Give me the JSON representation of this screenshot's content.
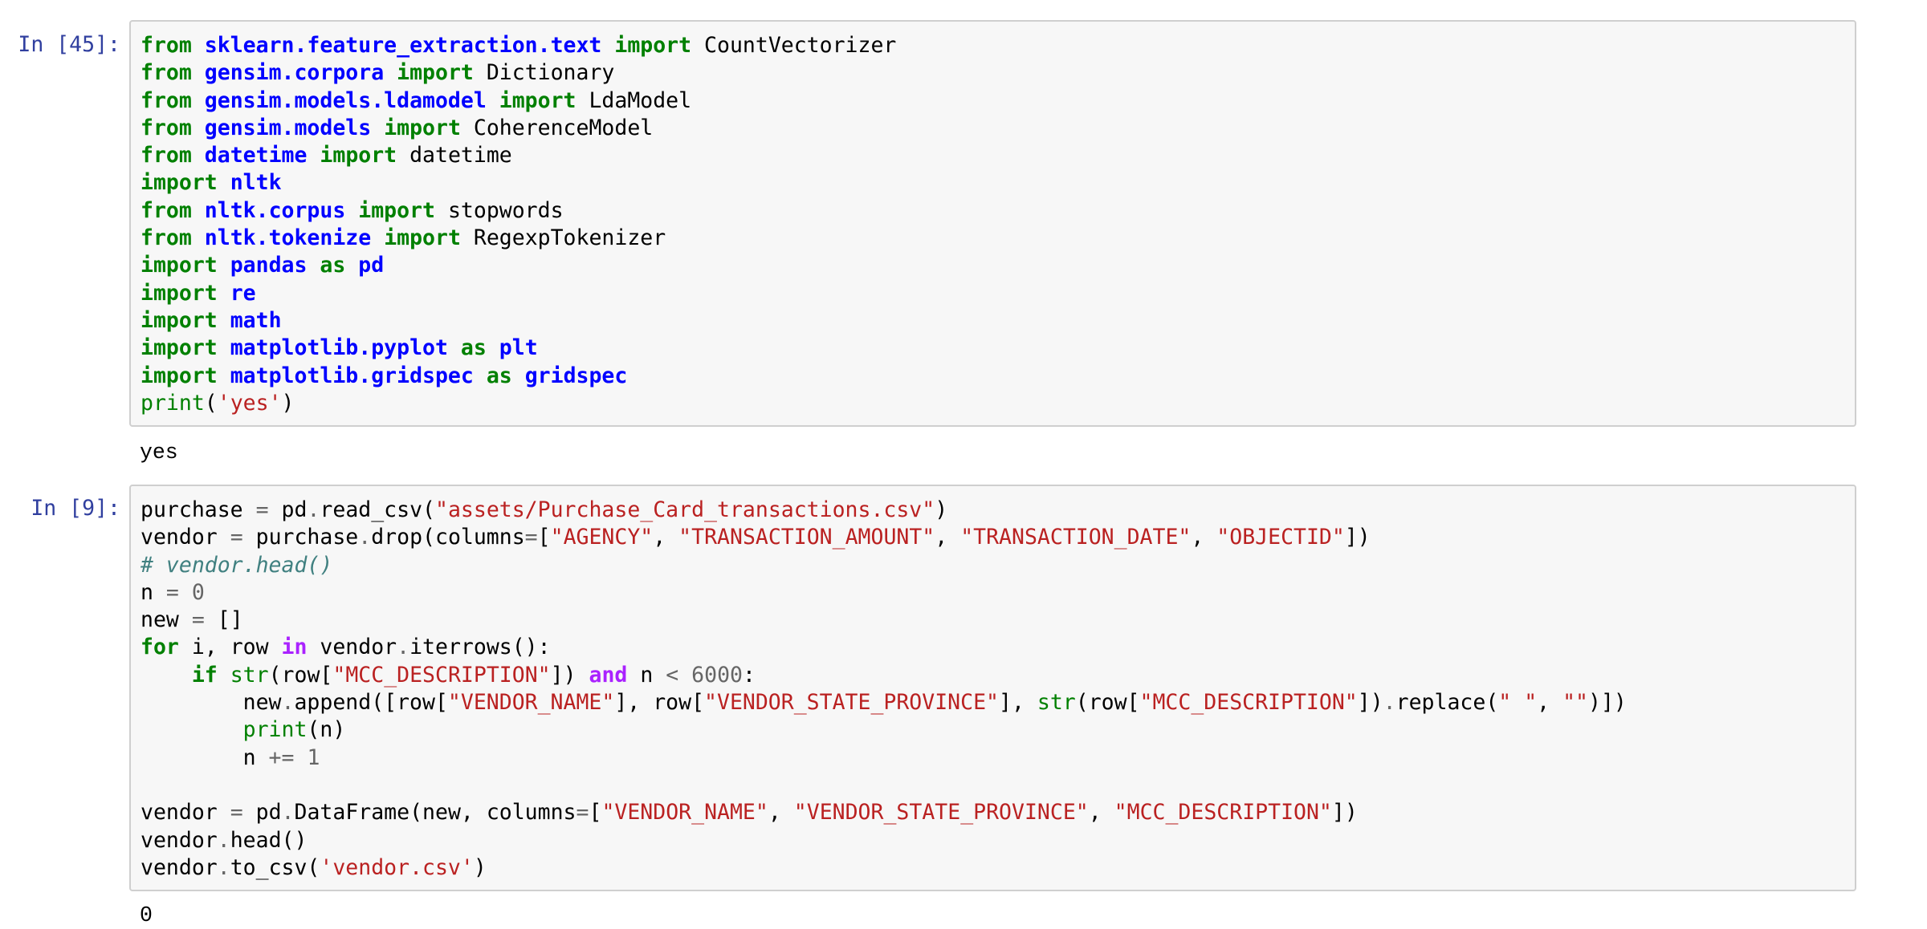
{
  "cells": [
    {
      "prompt": "In [45]:",
      "lines": [
        [
          [
            "kw",
            "from"
          ],
          [
            "t",
            " "
          ],
          [
            "nn",
            "sklearn.feature_extraction.text"
          ],
          [
            "t",
            " "
          ],
          [
            "kw",
            "import"
          ],
          [
            "t",
            " CountVectorizer"
          ]
        ],
        [
          [
            "kw",
            "from"
          ],
          [
            "t",
            " "
          ],
          [
            "nn",
            "gensim.corpora"
          ],
          [
            "t",
            " "
          ],
          [
            "kw",
            "import"
          ],
          [
            "t",
            " Dictionary"
          ]
        ],
        [
          [
            "kw",
            "from"
          ],
          [
            "t",
            " "
          ],
          [
            "nn",
            "gensim.models.ldamodel"
          ],
          [
            "t",
            " "
          ],
          [
            "kw",
            "import"
          ],
          [
            "t",
            " LdaModel"
          ]
        ],
        [
          [
            "kw",
            "from"
          ],
          [
            "t",
            " "
          ],
          [
            "nn",
            "gensim.models"
          ],
          [
            "t",
            " "
          ],
          [
            "kw",
            "import"
          ],
          [
            "t",
            " CoherenceModel"
          ]
        ],
        [
          [
            "kw",
            "from"
          ],
          [
            "t",
            " "
          ],
          [
            "nn",
            "datetime"
          ],
          [
            "t",
            " "
          ],
          [
            "kw",
            "import"
          ],
          [
            "t",
            " datetime"
          ]
        ],
        [
          [
            "kw",
            "import"
          ],
          [
            "t",
            " "
          ],
          [
            "nn",
            "nltk"
          ]
        ],
        [
          [
            "kw",
            "from"
          ],
          [
            "t",
            " "
          ],
          [
            "nn",
            "nltk.corpus"
          ],
          [
            "t",
            " "
          ],
          [
            "kw",
            "import"
          ],
          [
            "t",
            " stopwords"
          ]
        ],
        [
          [
            "kw",
            "from"
          ],
          [
            "t",
            " "
          ],
          [
            "nn",
            "nltk.tokenize"
          ],
          [
            "t",
            " "
          ],
          [
            "kw",
            "import"
          ],
          [
            "t",
            " RegexpTokenizer"
          ]
        ],
        [
          [
            "kw",
            "import"
          ],
          [
            "t",
            " "
          ],
          [
            "nn",
            "pandas"
          ],
          [
            "t",
            " "
          ],
          [
            "kw",
            "as"
          ],
          [
            "t",
            " "
          ],
          [
            "nn",
            "pd"
          ]
        ],
        [
          [
            "kw",
            "import"
          ],
          [
            "t",
            " "
          ],
          [
            "nn",
            "re"
          ]
        ],
        [
          [
            "kw",
            "import"
          ],
          [
            "t",
            " "
          ],
          [
            "nn",
            "math"
          ]
        ],
        [
          [
            "kw",
            "import"
          ],
          [
            "t",
            " "
          ],
          [
            "nn",
            "matplotlib.pyplot"
          ],
          [
            "t",
            " "
          ],
          [
            "kw",
            "as"
          ],
          [
            "t",
            " "
          ],
          [
            "nn",
            "plt"
          ]
        ],
        [
          [
            "kw",
            "import"
          ],
          [
            "t",
            " "
          ],
          [
            "nn",
            "matplotlib.gridspec"
          ],
          [
            "t",
            " "
          ],
          [
            "kw",
            "as"
          ],
          [
            "t",
            " "
          ],
          [
            "nn",
            "gridspec"
          ]
        ],
        [
          [
            "nb",
            "print"
          ],
          [
            "t",
            "("
          ],
          [
            "s",
            "'yes'"
          ],
          [
            "t",
            ")"
          ]
        ]
      ],
      "output": "yes"
    },
    {
      "prompt": "In [9]:",
      "lines": [
        [
          [
            "t",
            "purchase "
          ],
          [
            "o",
            "="
          ],
          [
            "t",
            " pd"
          ],
          [
            "o",
            "."
          ],
          [
            "t",
            "read_csv("
          ],
          [
            "s",
            "\"assets/Purchase_Card_transactions.csv\""
          ],
          [
            "t",
            ")"
          ]
        ],
        [
          [
            "t",
            "vendor "
          ],
          [
            "o",
            "="
          ],
          [
            "t",
            " purchase"
          ],
          [
            "o",
            "."
          ],
          [
            "t",
            "drop(columns"
          ],
          [
            "o",
            "="
          ],
          [
            "t",
            "["
          ],
          [
            "s",
            "\"AGENCY\""
          ],
          [
            "t",
            ", "
          ],
          [
            "s",
            "\"TRANSACTION_AMOUNT\""
          ],
          [
            "t",
            ", "
          ],
          [
            "s",
            "\"TRANSACTION_DATE\""
          ],
          [
            "t",
            ", "
          ],
          [
            "s",
            "\"OBJECTID\""
          ],
          [
            "t",
            "])"
          ]
        ],
        [
          [
            "c",
            "# vendor.head()"
          ]
        ],
        [
          [
            "t",
            "n "
          ],
          [
            "o",
            "="
          ],
          [
            "t",
            " "
          ],
          [
            "mi",
            "0"
          ]
        ],
        [
          [
            "t",
            "new "
          ],
          [
            "o",
            "="
          ],
          [
            "t",
            " []"
          ]
        ],
        [
          [
            "kw",
            "for"
          ],
          [
            "t",
            " i, row "
          ],
          [
            "ow",
            "in"
          ],
          [
            "t",
            " vendor"
          ],
          [
            "o",
            "."
          ],
          [
            "t",
            "iterrows():"
          ]
        ],
        [
          [
            "t",
            "    "
          ],
          [
            "kw",
            "if"
          ],
          [
            "t",
            " "
          ],
          [
            "nb",
            "str"
          ],
          [
            "t",
            "(row["
          ],
          [
            "s",
            "\"MCC_DESCRIPTION\""
          ],
          [
            "t",
            "]) "
          ],
          [
            "ow",
            "and"
          ],
          [
            "t",
            " n "
          ],
          [
            "o",
            "<"
          ],
          [
            "t",
            " "
          ],
          [
            "mi",
            "6000"
          ],
          [
            "t",
            ":"
          ]
        ],
        [
          [
            "t",
            "        new"
          ],
          [
            "o",
            "."
          ],
          [
            "t",
            "append([row["
          ],
          [
            "s",
            "\"VENDOR_NAME\""
          ],
          [
            "t",
            "], row["
          ],
          [
            "s",
            "\"VENDOR_STATE_PROVINCE\""
          ],
          [
            "t",
            "], "
          ],
          [
            "nb",
            "str"
          ],
          [
            "t",
            "(row["
          ],
          [
            "s",
            "\"MCC_DESCRIPTION\""
          ],
          [
            "t",
            "])"
          ],
          [
            "o",
            "."
          ],
          [
            "t",
            "replace("
          ],
          [
            "s",
            "\" \""
          ],
          [
            "t",
            ", "
          ],
          [
            "s",
            "\"\""
          ],
          [
            "t",
            ")])"
          ]
        ],
        [
          [
            "t",
            "        "
          ],
          [
            "nb",
            "print"
          ],
          [
            "t",
            "(n)"
          ]
        ],
        [
          [
            "t",
            "        n "
          ],
          [
            "o",
            "+="
          ],
          [
            "t",
            " "
          ],
          [
            "mi",
            "1"
          ]
        ],
        [
          [
            "t",
            ""
          ]
        ],
        [
          [
            "t",
            "vendor "
          ],
          [
            "o",
            "="
          ],
          [
            "t",
            " pd"
          ],
          [
            "o",
            "."
          ],
          [
            "t",
            "DataFrame(new, columns"
          ],
          [
            "o",
            "="
          ],
          [
            "t",
            "["
          ],
          [
            "s",
            "\"VENDOR_NAME\""
          ],
          [
            "t",
            ", "
          ],
          [
            "s",
            "\"VENDOR_STATE_PROVINCE\""
          ],
          [
            "t",
            ", "
          ],
          [
            "s",
            "\"MCC_DESCRIPTION\""
          ],
          [
            "t",
            "])"
          ]
        ],
        [
          [
            "t",
            "vendor"
          ],
          [
            "o",
            "."
          ],
          [
            "t",
            "head()"
          ]
        ],
        [
          [
            "t",
            "vendor"
          ],
          [
            "o",
            "."
          ],
          [
            "t",
            "to_csv("
          ],
          [
            "s",
            "'vendor.csv'"
          ],
          [
            "t",
            ")"
          ]
        ]
      ],
      "output": "0"
    }
  ]
}
